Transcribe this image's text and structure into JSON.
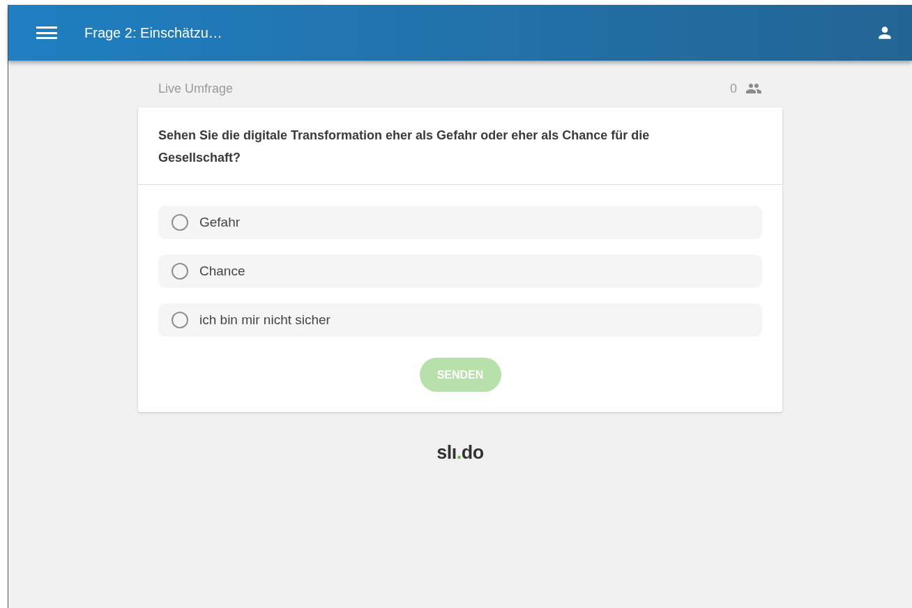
{
  "app_bar": {
    "title": "Frage 2: Einschätzu…"
  },
  "poll": {
    "label": "Live Umfrage",
    "participants": "0"
  },
  "question": "Sehen Sie die digitale Transformation eher als Gefahr oder eher als Chance für die Gesellschaft?",
  "options": [
    {
      "label": "Gefahr",
      "selected": false
    },
    {
      "label": "Chance",
      "selected": false
    },
    {
      "label": "ich bin mir nicht sicher",
      "selected": false
    }
  ],
  "submit": {
    "label": "SENDEN",
    "disabled": true
  },
  "logo": {
    "left": "slı",
    "dot": ".",
    "right": "do"
  }
}
